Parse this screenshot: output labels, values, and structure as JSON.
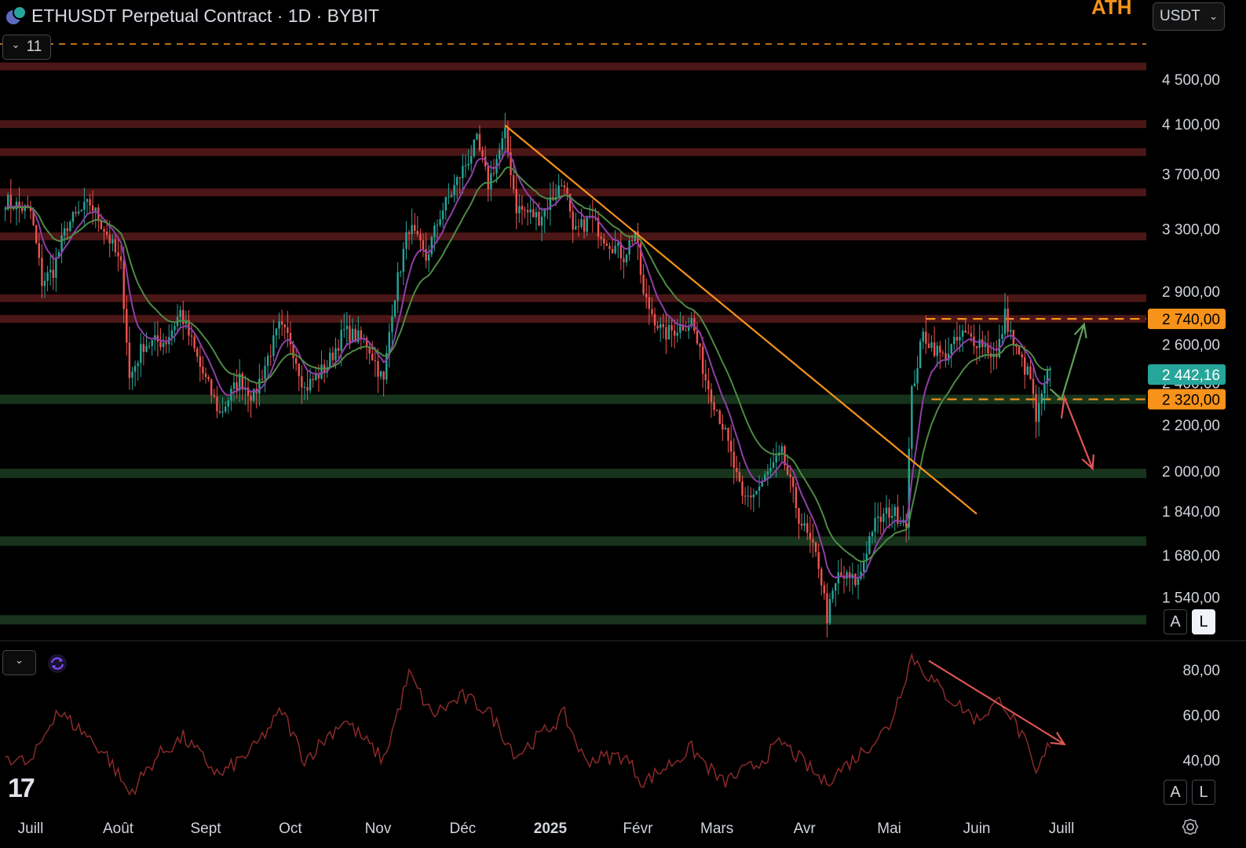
{
  "header": {
    "symbol_title": "ETHUSDT Perpetual Contract · 1D · BYBIT",
    "coin_icon": "eth-usdt-coin-icon",
    "ath_label": "ATH",
    "currency": "USDT",
    "indicator_count": "11"
  },
  "toolbar": {
    "scale_auto": "A",
    "scale_log": "L",
    "rsi_scale_auto": "A",
    "rsi_scale_log": "L"
  },
  "colors": {
    "bull": "#26a69a",
    "bear": "#ef5350",
    "resistance_zone": "#4a1616",
    "support_zone": "#17331b",
    "accent_orange": "#f7931a",
    "ema_fast": "#8e3fa8",
    "ema_slow": "#4e8a45",
    "rsi_line": "#8b2a2a",
    "price_badge": "#26a69a"
  },
  "chart_data": [
    {
      "type": "candlestick",
      "title": "ETHUSDT Perpetual Contract · 1D · BYBIT",
      "y_scale": "log",
      "ylim": [
        1410,
        5000
      ],
      "y_ticks": [
        {
          "v": 4500,
          "label": "4 500,00"
        },
        {
          "v": 4100,
          "label": "4 100,00"
        },
        {
          "v": 3700,
          "label": "3 700,00"
        },
        {
          "v": 3300,
          "label": "3 300,00"
        },
        {
          "v": 2900,
          "label": "2 900,00"
        },
        {
          "v": 2600,
          "label": "2 600,00"
        },
        {
          "v": 2400,
          "label": "2 400,00"
        },
        {
          "v": 2200,
          "label": "2 200,00"
        },
        {
          "v": 2000,
          "label": "2 000,00"
        },
        {
          "v": 1840,
          "label": "1 840,00"
        },
        {
          "v": 1680,
          "label": "1 680,00"
        },
        {
          "v": 1540,
          "label": "1 540,00"
        }
      ],
      "x_axis_labels": [
        {
          "date": "2024-07-01",
          "label": "Juill",
          "bold": false
        },
        {
          "date": "2024-08-01",
          "label": "Août",
          "bold": false
        },
        {
          "date": "2024-09-01",
          "label": "Sept",
          "bold": false
        },
        {
          "date": "2024-10-01",
          "label": "Oct",
          "bold": false
        },
        {
          "date": "2024-11-01",
          "label": "Nov",
          "bold": false
        },
        {
          "date": "2024-12-01",
          "label": "Déc",
          "bold": false
        },
        {
          "date": "2025-01-01",
          "label": "2025",
          "bold": true
        },
        {
          "date": "2025-02-01",
          "label": "Févr",
          "bold": false
        },
        {
          "date": "2025-03-01",
          "label": "Mars",
          "bold": false
        },
        {
          "date": "2025-04-01",
          "label": "Avr",
          "bold": false
        },
        {
          "date": "2025-05-01",
          "label": "Mai",
          "bold": false
        },
        {
          "date": "2025-06-01",
          "label": "Juin",
          "bold": false
        },
        {
          "date": "2025-07-01",
          "label": "Juill",
          "bold": false
        }
      ],
      "price_path": [
        [
          "2024-06-22",
          3500
        ],
        [
          "2024-07-01",
          3420
        ],
        [
          "2024-07-05",
          2960
        ],
        [
          "2024-07-09",
          3030
        ],
        [
          "2024-07-14",
          3330
        ],
        [
          "2024-07-22",
          3480
        ],
        [
          "2024-07-28",
          3270
        ],
        [
          "2024-08-02",
          3050
        ],
        [
          "2024-08-05",
          2420
        ],
        [
          "2024-08-10",
          2600
        ],
        [
          "2024-08-18",
          2620
        ],
        [
          "2024-08-23",
          2780
        ],
        [
          "2024-08-30",
          2480
        ],
        [
          "2024-09-06",
          2250
        ],
        [
          "2024-09-13",
          2420
        ],
        [
          "2024-09-18",
          2330
        ],
        [
          "2024-09-27",
          2690
        ],
        [
          "2024-10-01",
          2620
        ],
        [
          "2024-10-06",
          2370
        ],
        [
          "2024-10-14",
          2490
        ],
        [
          "2024-10-20",
          2670
        ],
        [
          "2024-10-28",
          2610
        ],
        [
          "2024-11-03",
          2400
        ],
        [
          "2024-11-06",
          2800
        ],
        [
          "2024-11-12",
          3320
        ],
        [
          "2024-11-18",
          3100
        ],
        [
          "2024-11-23",
          3400
        ],
        [
          "2024-11-28",
          3600
        ],
        [
          "2024-12-06",
          3950
        ],
        [
          "2024-12-10",
          3620
        ],
        [
          "2024-12-16",
          4010
        ],
        [
          "2024-12-20",
          3450
        ],
        [
          "2024-12-28",
          3380
        ],
        [
          "2025-01-06",
          3650
        ],
        [
          "2025-01-09",
          3250
        ],
        [
          "2025-01-15",
          3380
        ],
        [
          "2025-01-20",
          3250
        ],
        [
          "2025-01-27",
          3120
        ],
        [
          "2025-01-31",
          3290
        ],
        [
          "2025-02-03",
          2870
        ],
        [
          "2025-02-10",
          2650
        ],
        [
          "2025-02-20",
          2730
        ],
        [
          "2025-02-25",
          2420
        ],
        [
          "2025-03-03",
          2200
        ],
        [
          "2025-03-10",
          1880
        ],
        [
          "2025-03-15",
          1920
        ],
        [
          "2025-03-24",
          2070
        ],
        [
          "2025-03-30",
          1820
        ],
        [
          "2025-04-06",
          1650
        ],
        [
          "2025-04-09",
          1480
        ],
        [
          "2025-04-13",
          1610
        ],
        [
          "2025-04-20",
          1590
        ],
        [
          "2025-04-25",
          1780
        ],
        [
          "2025-05-01",
          1840
        ],
        [
          "2025-05-07",
          1810
        ],
        [
          "2025-05-09",
          2350
        ],
        [
          "2025-05-13",
          2650
        ],
        [
          "2025-05-20",
          2530
        ],
        [
          "2025-05-27",
          2650
        ],
        [
          "2025-06-03",
          2610
        ],
        [
          "2025-06-08",
          2520
        ],
        [
          "2025-06-11",
          2760
        ],
        [
          "2025-06-15",
          2560
        ],
        [
          "2025-06-20",
          2420
        ],
        [
          "2025-06-22",
          2220
        ],
        [
          "2025-06-26",
          2430
        ],
        [
          "2025-06-27",
          2442
        ]
      ],
      "last_price": 2442.16,
      "last_price_label": "2 442,16",
      "levels": {
        "resistance_zones": [
          4620,
          4100,
          3870,
          3560,
          3250,
          2860,
          2740
        ],
        "support_zones": [
          2320,
          1990,
          1730,
          1470
        ]
      },
      "key_levels": [
        {
          "price": 2740,
          "label": "2 740,00",
          "style": "dashed-orange"
        },
        {
          "price": 2320,
          "label": "2 320,00",
          "style": "dashed-orange"
        }
      ],
      "ath_line": 4840,
      "trendline": {
        "from": [
          "2024-12-16",
          4090
        ],
        "to": [
          "2025-06-01",
          1830
        ]
      },
      "scenarios": [
        {
          "name": "bullish",
          "points": [
            [
              "2025-06-27",
              2370
            ],
            [
              "2025-07-01",
              2320
            ],
            [
              "2025-07-09",
              2710
            ]
          ],
          "color": "#5fa35a"
        },
        {
          "name": "bearish",
          "points": [
            [
              "2025-07-01",
              2230
            ],
            [
              "2025-07-02",
              2330
            ],
            [
              "2025-07-12",
              2010
            ]
          ],
          "color": "#e05555"
        }
      ],
      "moving_averages": [
        {
          "period": 9,
          "color": "#8e3fa8"
        },
        {
          "period": 21,
          "color": "#4e8a45"
        }
      ]
    },
    {
      "type": "line",
      "y_ticks": [
        {
          "v": 80,
          "label": "80,00"
        },
        {
          "v": 60,
          "label": "60,00"
        },
        {
          "v": 40,
          "label": "40,00"
        }
      ],
      "ylim": [
        25,
        90
      ],
      "rsi_path": [
        [
          "2024-06-22",
          42
        ],
        [
          "2024-07-01",
          38
        ],
        [
          "2024-07-10",
          62
        ],
        [
          "2024-07-20",
          52
        ],
        [
          "2024-07-28",
          42
        ],
        [
          "2024-08-05",
          25
        ],
        [
          "2024-08-15",
          42
        ],
        [
          "2024-08-24",
          50
        ],
        [
          "2024-09-06",
          33
        ],
        [
          "2024-09-18",
          45
        ],
        [
          "2024-09-28",
          62
        ],
        [
          "2024-10-06",
          40
        ],
        [
          "2024-10-20",
          58
        ],
        [
          "2024-11-03",
          40
        ],
        [
          "2024-11-12",
          78
        ],
        [
          "2024-11-20",
          60
        ],
        [
          "2024-12-01",
          68
        ],
        [
          "2024-12-10",
          62
        ],
        [
          "2024-12-20",
          42
        ],
        [
          "2025-01-06",
          60
        ],
        [
          "2025-01-13",
          40
        ],
        [
          "2025-01-27",
          42
        ],
        [
          "2025-02-03",
          30
        ],
        [
          "2025-02-20",
          45
        ],
        [
          "2025-03-03",
          30
        ],
        [
          "2025-03-15",
          38
        ],
        [
          "2025-03-24",
          48
        ],
        [
          "2025-04-08",
          30
        ],
        [
          "2025-04-20",
          42
        ],
        [
          "2025-05-01",
          55
        ],
        [
          "2025-05-09",
          86
        ],
        [
          "2025-05-20",
          70
        ],
        [
          "2025-06-01",
          58
        ],
        [
          "2025-06-10",
          67
        ],
        [
          "2025-06-18",
          48
        ],
        [
          "2025-06-22",
          33
        ],
        [
          "2025-06-27",
          48
        ]
      ],
      "divergence_arrow": {
        "from": [
          "2025-05-15",
          84
        ],
        "to": [
          "2025-07-02",
          47
        ],
        "color": "#e05555"
      }
    }
  ]
}
